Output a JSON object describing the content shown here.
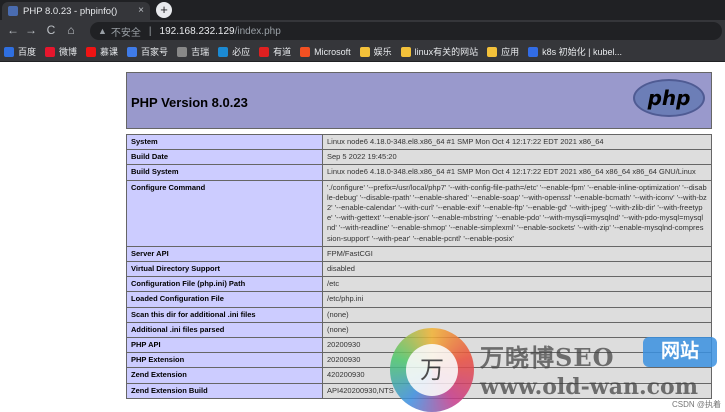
{
  "browser": {
    "tab_title": "PHP 8.0.23 - phpinfo()",
    "tab_close": "×",
    "new_tab": "+",
    "nav": {
      "back": "←",
      "forward": "→",
      "reload": "C",
      "home": "⌂"
    },
    "address": {
      "security": "不安全",
      "separator": "|",
      "host": "192.168.232.129",
      "path": "/index.php"
    },
    "bookmarks": [
      {
        "label": "百度",
        "color": "#2f6fe0"
      },
      {
        "label": "微博",
        "color": "#e6162d"
      },
      {
        "label": "慕课",
        "color": "#f01414"
      },
      {
        "label": "百家号",
        "color": "#3f7be8"
      },
      {
        "label": "吉瑞",
        "color": "#888888"
      },
      {
        "label": "必应",
        "color": "#1b8ad3"
      },
      {
        "label": "有道",
        "color": "#e02020"
      },
      {
        "label": "Microsoft",
        "color": "#f25022"
      },
      {
        "label": "娱乐",
        "color": "#f3c13a"
      },
      {
        "label": "linux有关的网站",
        "color": "#f3c13a"
      },
      {
        "label": "应用",
        "color": "#f3c13a"
      },
      {
        "label": "k8s 初始化 | kubel...",
        "color": "#326ce5"
      }
    ]
  },
  "page": {
    "title": "PHP Version 8.0.23",
    "logo_text": "php",
    "rows": [
      {
        "label": "System",
        "value": "Linux node6 4.18.0-348.el8.x86_64 #1 SMP Mon Oct 4 12:17:22 EDT 2021 x86_64"
      },
      {
        "label": "Build Date",
        "value": "Sep 5 2022 19:45:20"
      },
      {
        "label": "Build System",
        "value": "Linux node6 4.18.0-348.el8.x86_64 #1 SMP Mon Oct 4 12:17:22 EDT 2021 x86_64 x86_64 x86_64 GNU/Linux"
      },
      {
        "label": "Configure Command",
        "value": "'./configure' '--prefix=/usr/local/php7' '--with-config-file-path=/etc' '--enable-fpm' '--enable-inline-optimization' '--disable-debug' '--disable-rpath' '--enable-shared' '--enable-soap' '--with-openssl' '--enable-bcmath' '--with-iconv' '--with-bz2' '--enable-calendar' '--with-curl' '--enable-exif' '--enable-ftp' '--enable-gd' '--with-jpeg' '--with-zlib-dir' '--with-freetype' '--with-gettext' '--enable-json' '--enable-mbstring' '--enable-pdo' '--with-mysqli=mysqlnd' '--with-pdo-mysql=mysqlnd' '--with-readline' '--enable-shmop' '--enable-simplexml' '--enable-sockets' '--with-zip' '--enable-mysqlnd-compression-support' '--with-pear' '--enable-pcntl' '--enable-posix'"
      },
      {
        "label": "Server API",
        "value": "FPM/FastCGI"
      },
      {
        "label": "Virtual Directory Support",
        "value": "disabled"
      },
      {
        "label": "Configuration File (php.ini) Path",
        "value": "/etc"
      },
      {
        "label": "Loaded Configuration File",
        "value": "/etc/php.ini"
      },
      {
        "label": "Scan this dir for additional .ini files",
        "value": "(none)"
      },
      {
        "label": "Additional .ini files parsed",
        "value": "(none)"
      },
      {
        "label": "PHP API",
        "value": "20200930"
      },
      {
        "label": "PHP Extension",
        "value": "20200930"
      },
      {
        "label": "Zend Extension",
        "value": "420200930"
      },
      {
        "label": "Zend Extension Build",
        "value": "API420200930,NTS"
      }
    ]
  },
  "watermark": {
    "logo_char": "万",
    "title": "万晓博SEO",
    "badge": "网站",
    "url": "www.old-wan.com",
    "credit": "CSDN @执着"
  }
}
